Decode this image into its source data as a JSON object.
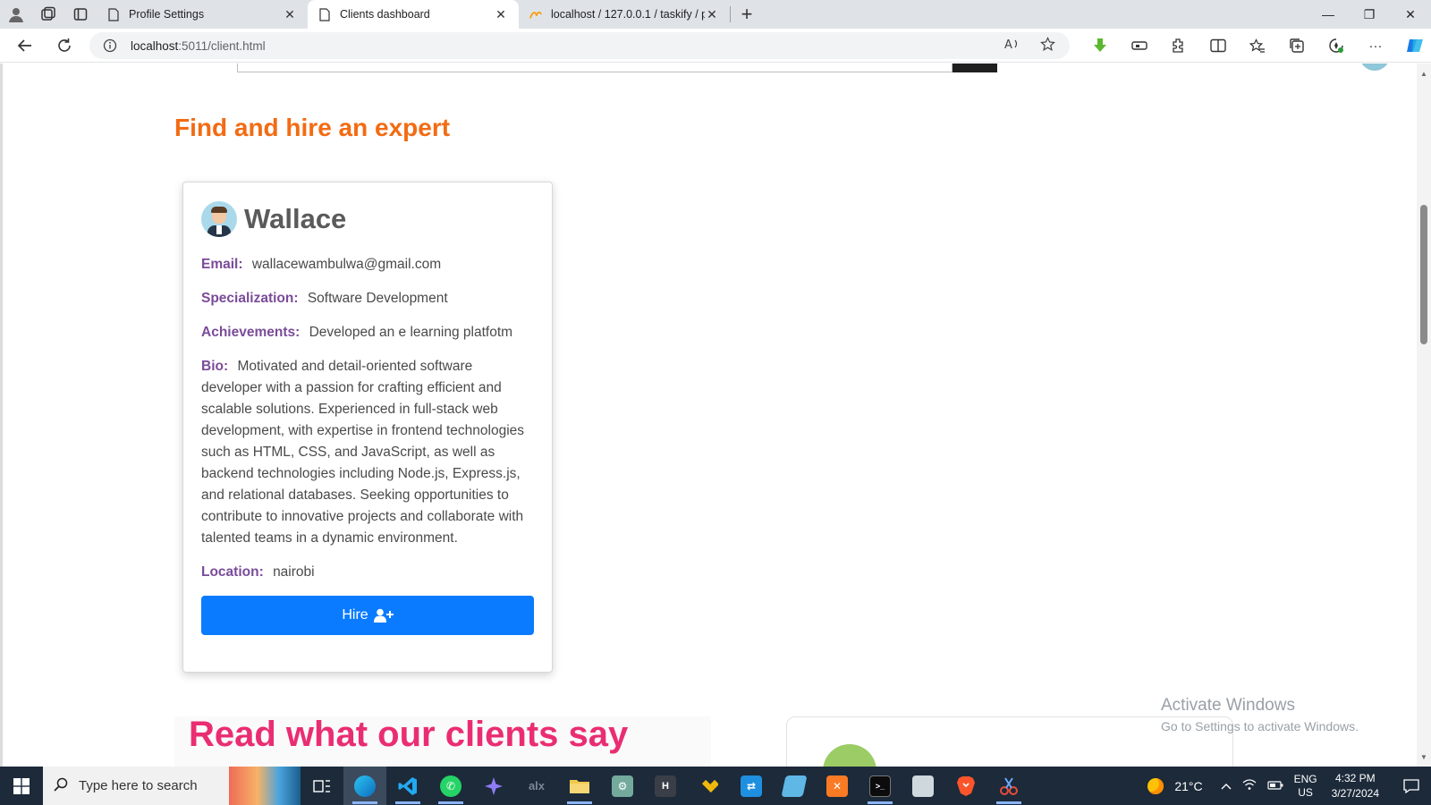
{
  "browser": {
    "tabs": [
      {
        "label": "Profile Settings",
        "favicon": "page-icon",
        "active": false
      },
      {
        "label": "Clients dashboard",
        "favicon": "page-icon",
        "active": true
      },
      {
        "label": "localhost / 127.0.0.1 / taskify / pc",
        "favicon": "phpmyadmin-icon",
        "active": false
      }
    ],
    "url_host": "localhost",
    "url_rest": ":5011/client.html"
  },
  "page": {
    "heading": "Find and hire an expert",
    "expert": {
      "name": "Wallace",
      "email_label": "Email:",
      "email": "wallacewambulwa@gmail.com",
      "specialization_label": "Specialization:",
      "specialization": "Software Development",
      "achievements_label": "Achievements:",
      "achievements": "Developed an e learning platfotm",
      "bio_label": "Bio:",
      "bio": "Motivated and detail-oriented software developer with a passion for crafting efficient and scalable solutions. Experienced in full-stack web development, with expertise in frontend technologies such as HTML, CSS, and JavaScript, as well as backend technologies including Node.js, Express.js, and relational databases. Seeking opportunities to contribute to innovative projects and collaborate with talented teams in a dynamic environment.",
      "location_label": "Location:",
      "location": "nairobi",
      "hire_label": "Hire"
    },
    "testimonials_heading": "Read what our clients say"
  },
  "watermark": {
    "line1": "Activate Windows",
    "line2": "Go to Settings to activate Windows."
  },
  "taskbar": {
    "search_placeholder": "Type here to search",
    "temperature": "21°C",
    "lang_line1": "ENG",
    "lang_line2": "US",
    "time": "4:32 PM",
    "date": "3/27/2024"
  },
  "colors": {
    "heading": "#f36b13",
    "label": "#7a4b9a",
    "hire_button": "#0a7bff",
    "testimonials_heading": "#ea2d72"
  }
}
